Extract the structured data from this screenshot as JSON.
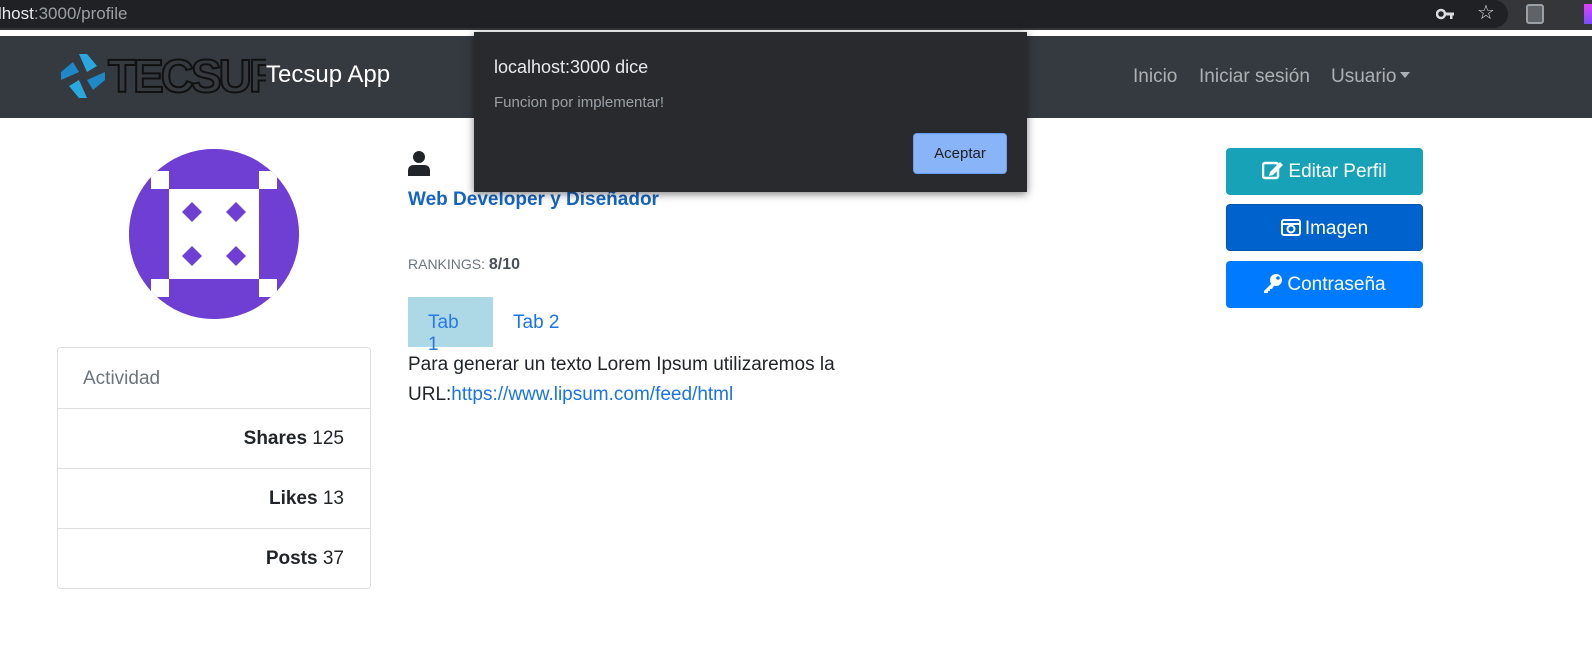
{
  "browser": {
    "url_prefix": "calhost",
    "url_suffix": ":3000/profile"
  },
  "navbar": {
    "brand": "Tecsup App",
    "links": [
      "Inicio",
      "Iniciar sesión",
      "Usuario"
    ]
  },
  "activity": {
    "header": "Actividad",
    "rows": [
      {
        "label": "Shares",
        "value": "125"
      },
      {
        "label": "Likes",
        "value": "13"
      },
      {
        "label": "Posts",
        "value": "37"
      }
    ]
  },
  "profile": {
    "role": "Web Developer y Diseñador",
    "rankings_label": "RANKINGS:",
    "rankings_value": "8/10",
    "tabs": [
      "Tab 1",
      "Tab 2"
    ],
    "tab_text": "Para generar un texto Lorem Ipsum utilizaremos la URL:",
    "tab_link": "https://www.lipsum.com/feed/html"
  },
  "actions": {
    "edit": "Editar Perfil",
    "image": "Imagen",
    "password": "Contraseña"
  },
  "dialog": {
    "title": "localhost:3000 dice",
    "message": "Funcion por implementar!",
    "accept": "Aceptar"
  },
  "colors": {
    "navbar": "#343a40",
    "avatar": "#6f3fd4",
    "edit_button": "#17a2b8",
    "image_button": "#0062cc",
    "password_button": "#007bff",
    "dialog_button": "#8ab4f8"
  }
}
